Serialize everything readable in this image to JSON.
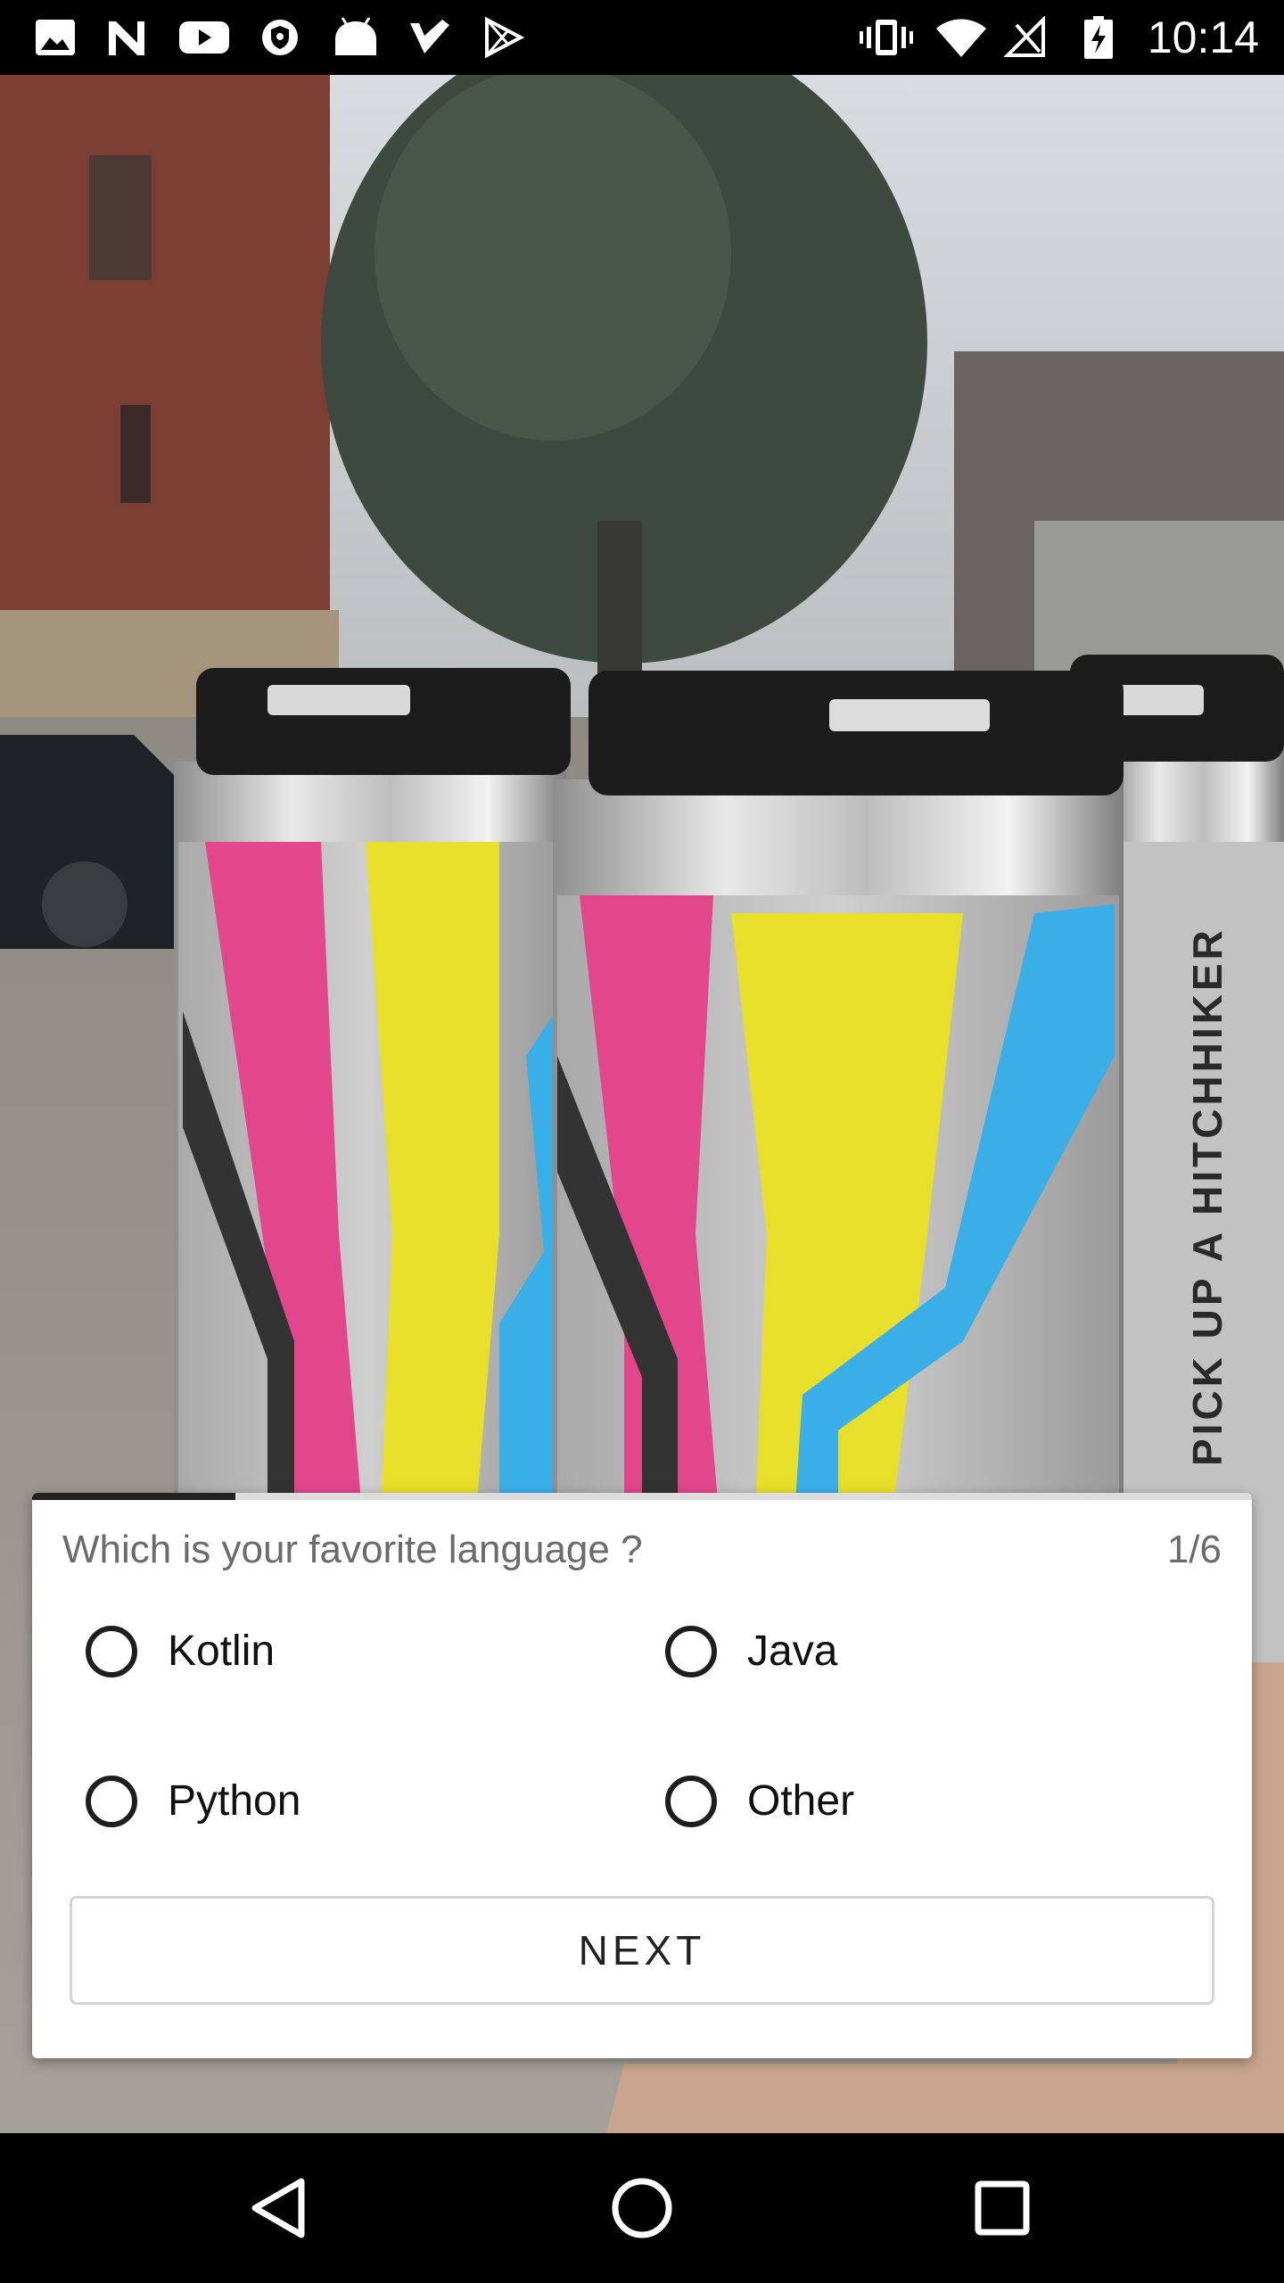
{
  "status_bar": {
    "time": "10:14",
    "left_icons": [
      "gallery-icon",
      "n-icon",
      "youtube-icon",
      "shield-icon",
      "android-icon",
      "check-icon",
      "play-store-icon"
    ],
    "right_icons": [
      "vibrate-icon",
      "wifi-icon",
      "no-signal-icon",
      "battery-charging-icon"
    ]
  },
  "photo": {
    "can_label_text": "PICK UP A HITCHHIKER"
  },
  "survey": {
    "question": "Which is your favorite language ?",
    "counter": "1/6",
    "progress": 0.167,
    "options": [
      {
        "label": "Kotlin",
        "selected": false
      },
      {
        "label": "Java",
        "selected": false
      },
      {
        "label": "Python",
        "selected": false
      },
      {
        "label": "Other",
        "selected": false
      }
    ],
    "next_label": "NEXT"
  },
  "nav_bar": {
    "buttons": [
      "back-icon",
      "home-icon",
      "recents-icon"
    ]
  },
  "colors": {
    "card_background": "#ffffff",
    "text_primary": "#111111",
    "text_secondary": "#6b6b6b",
    "progress": "#222222",
    "bars": "#000000"
  }
}
